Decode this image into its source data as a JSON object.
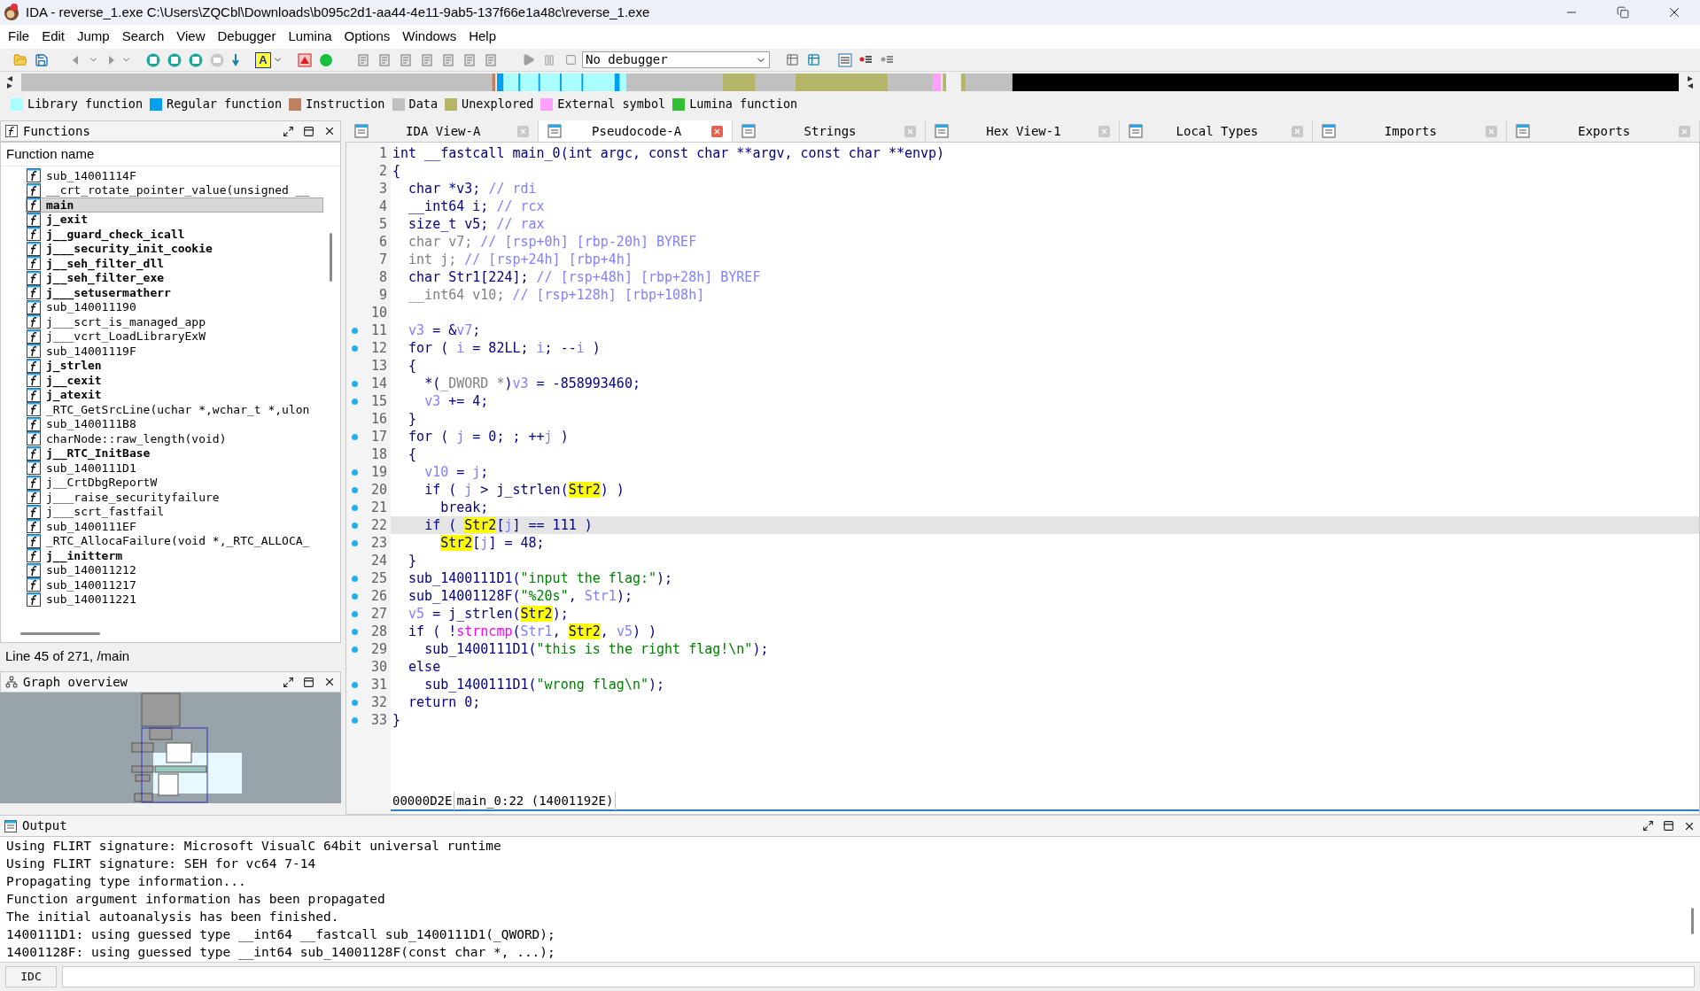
{
  "window": {
    "title": "IDA - reverse_1.exe C:\\Users\\ZQCbl\\Downloads\\b095c2d1-aa44-4e11-9ab5-137f66e1a48c\\reverse_1.exe"
  },
  "menu": [
    "File",
    "Edit",
    "Jump",
    "Search",
    "View",
    "Debugger",
    "Lumina",
    "Options",
    "Windows",
    "Help"
  ],
  "toolbar": {
    "font_button": "A",
    "debugger": "No debugger"
  },
  "legend": [
    {
      "label": "Library function",
      "color": "#aaffff"
    },
    {
      "label": "Regular function",
      "color": "#00a0f0"
    },
    {
      "label": "Instruction",
      "color": "#c08060"
    },
    {
      "label": "Data",
      "color": "#c0c0c0"
    },
    {
      "label": "Unexplored",
      "color": "#b5b56a"
    },
    {
      "label": "External symbol",
      "color": "#ffa0ff"
    },
    {
      "label": "Lumina function",
      "color": "#30c030"
    }
  ],
  "functions": {
    "title": "Functions",
    "column": "Function name",
    "status": "Line 45 of 271, /main",
    "items": [
      {
        "name": "sub_14001114F",
        "bold": false,
        "selected": false
      },
      {
        "name": "__crt_rotate_pointer_value(unsigned __",
        "bold": false,
        "selected": false
      },
      {
        "name": "main",
        "bold": true,
        "selected": true
      },
      {
        "name": "j_exit",
        "bold": true,
        "selected": false
      },
      {
        "name": "j__guard_check_icall",
        "bold": true,
        "selected": false
      },
      {
        "name": "j___security_init_cookie",
        "bold": true,
        "selected": false
      },
      {
        "name": "j__seh_filter_dll",
        "bold": true,
        "selected": false
      },
      {
        "name": "j__seh_filter_exe",
        "bold": true,
        "selected": false
      },
      {
        "name": "j___setusermatherr",
        "bold": true,
        "selected": false
      },
      {
        "name": "sub_140011190",
        "bold": false,
        "selected": false
      },
      {
        "name": "j___scrt_is_managed_app",
        "bold": false,
        "selected": false
      },
      {
        "name": "j___vcrt_LoadLibraryExW",
        "bold": false,
        "selected": false
      },
      {
        "name": "sub_14001119F",
        "bold": false,
        "selected": false
      },
      {
        "name": "j_strlen",
        "bold": true,
        "selected": false
      },
      {
        "name": "j__cexit",
        "bold": true,
        "selected": false
      },
      {
        "name": "j_atexit",
        "bold": true,
        "selected": false
      },
      {
        "name": "_RTC_GetSrcLine(uchar *,wchar_t *,ulon",
        "bold": false,
        "selected": false
      },
      {
        "name": "sub_1400111B8",
        "bold": false,
        "selected": false
      },
      {
        "name": "charNode::raw_length(void)",
        "bold": false,
        "selected": false
      },
      {
        "name": "j__RTC_InitBase",
        "bold": true,
        "selected": false
      },
      {
        "name": "sub_1400111D1",
        "bold": false,
        "selected": false
      },
      {
        "name": "j__CrtDbgReportW",
        "bold": false,
        "selected": false
      },
      {
        "name": "j___raise_securityfailure",
        "bold": false,
        "selected": false
      },
      {
        "name": "j___scrt_fastfail",
        "bold": false,
        "selected": false
      },
      {
        "name": "sub_1400111EF",
        "bold": false,
        "selected": false
      },
      {
        "name": "_RTC_AllocaFailure(void *,_RTC_ALLOCA_",
        "bold": false,
        "selected": false
      },
      {
        "name": "j__initterm",
        "bold": true,
        "selected": false
      },
      {
        "name": "sub_140011212",
        "bold": false,
        "selected": false
      },
      {
        "name": "sub_140011217",
        "bold": false,
        "selected": false
      },
      {
        "name": "sub_140011221",
        "bold": false,
        "selected": false
      }
    ]
  },
  "graph_overview": {
    "title": "Graph overview"
  },
  "tabs": [
    {
      "label": "IDA View-A",
      "selected": false
    },
    {
      "label": "Pseudocode-A",
      "selected": true
    },
    {
      "label": "Strings",
      "selected": false
    },
    {
      "label": "Hex View-1",
      "selected": false
    },
    {
      "label": "Local Types",
      "selected": false
    },
    {
      "label": "Imports",
      "selected": false
    },
    {
      "label": "Exports",
      "selected": false
    }
  ],
  "code": {
    "lines": [
      {
        "n": "1",
        "marked": false,
        "current": false,
        "tokens": [
          {
            "text": "int __fastcall main_0(int argc, const char **argv, const char **envp)",
            "kind": "plain"
          }
        ]
      },
      {
        "n": "2",
        "marked": false,
        "current": false,
        "tokens": [
          {
            "text": "{",
            "kind": "plain"
          }
        ]
      },
      {
        "n": "3",
        "marked": false,
        "current": false,
        "tokens": [
          {
            "text": "  char *v3; ",
            "kind": "plain"
          },
          {
            "text": "// rdi",
            "kind": "comment"
          }
        ]
      },
      {
        "n": "4",
        "marked": false,
        "current": false,
        "tokens": [
          {
            "text": "  __int64 i; ",
            "kind": "plain"
          },
          {
            "text": "// rcx",
            "kind": "comment"
          }
        ]
      },
      {
        "n": "5",
        "marked": false,
        "current": false,
        "tokens": [
          {
            "text": "  size_t v5; ",
            "kind": "plain"
          },
          {
            "text": "// rax",
            "kind": "comment"
          }
        ]
      },
      {
        "n": "6",
        "marked": false,
        "current": false,
        "tokens": [
          {
            "text": "  char v7; ",
            "kind": "dim"
          },
          {
            "text": "// [rsp+0h] [rbp-20h] BYREF",
            "kind": "comment"
          }
        ]
      },
      {
        "n": "7",
        "marked": false,
        "current": false,
        "tokens": [
          {
            "text": "  int j; ",
            "kind": "dim"
          },
          {
            "text": "// [rsp+24h] [rbp+4h]",
            "kind": "comment"
          }
        ]
      },
      {
        "n": "8",
        "marked": false,
        "current": false,
        "tokens": [
          {
            "text": "  char Str1[224]; ",
            "kind": "plain"
          },
          {
            "text": "// [rsp+48h] [rbp+28h] BYREF",
            "kind": "comment"
          }
        ]
      },
      {
        "n": "9",
        "marked": false,
        "current": false,
        "tokens": [
          {
            "text": "  __int64 v10; ",
            "kind": "dim"
          },
          {
            "text": "// [rsp+128h] [rbp+108h]",
            "kind": "comment"
          }
        ]
      },
      {
        "n": "10",
        "marked": false,
        "current": false
      },
      {
        "n": "11",
        "marked": true,
        "current": false,
        "tokens": [
          {
            "text": "  v3",
            "kind": "var"
          },
          {
            "text": " = &",
            "kind": "plain"
          },
          {
            "text": "v7",
            "kind": "var"
          },
          {
            "text": ";",
            "kind": "plain"
          }
        ]
      },
      {
        "n": "12",
        "marked": true,
        "current": false,
        "tokens": [
          {
            "text": "  for ( ",
            "kind": "plain"
          },
          {
            "text": "i",
            "kind": "var"
          },
          {
            "text": " = 82LL; ",
            "kind": "plain"
          },
          {
            "text": "i",
            "kind": "var"
          },
          {
            "text": "; --",
            "kind": "plain"
          },
          {
            "text": "i",
            "kind": "var"
          },
          {
            "text": " )",
            "kind": "plain"
          }
        ]
      },
      {
        "n": "13",
        "marked": false,
        "current": false,
        "tokens": [
          {
            "text": "  {",
            "kind": "plain"
          }
        ]
      },
      {
        "n": "14",
        "marked": true,
        "current": false,
        "tokens": [
          {
            "text": "    *(",
            "kind": "plain"
          },
          {
            "text": "_DWORD *",
            "kind": "dim"
          },
          {
            "text": ")",
            "kind": "plain"
          },
          {
            "text": "v3",
            "kind": "var"
          },
          {
            "text": " = -858993460;",
            "kind": "plain"
          }
        ]
      },
      {
        "n": "15",
        "marked": true,
        "current": false,
        "tokens": [
          {
            "text": "    v3",
            "kind": "var"
          },
          {
            "text": " += 4;",
            "kind": "plain"
          }
        ]
      },
      {
        "n": "16",
        "marked": false,
        "current": false,
        "tokens": [
          {
            "text": "  }",
            "kind": "plain"
          }
        ]
      },
      {
        "n": "17",
        "marked": true,
        "current": false,
        "tokens": [
          {
            "text": "  for ( ",
            "kind": "plain"
          },
          {
            "text": "j",
            "kind": "var"
          },
          {
            "text": " = 0; ; ++",
            "kind": "plain"
          },
          {
            "text": "j",
            "kind": "var"
          },
          {
            "text": " )",
            "kind": "plain"
          }
        ]
      },
      {
        "n": "18",
        "marked": false,
        "current": false,
        "tokens": [
          {
            "text": "  {",
            "kind": "plain"
          }
        ]
      },
      {
        "n": "19",
        "marked": true,
        "current": false,
        "tokens": [
          {
            "text": "    v10",
            "kind": "var"
          },
          {
            "text": " = ",
            "kind": "plain"
          },
          {
            "text": "j",
            "kind": "var"
          },
          {
            "text": ";",
            "kind": "plain"
          }
        ]
      },
      {
        "n": "20",
        "marked": true,
        "current": false,
        "tokens": [
          {
            "text": "    if ( ",
            "kind": "plain"
          },
          {
            "text": "j",
            "kind": "var"
          },
          {
            "text": " > j_strlen(",
            "kind": "plain"
          },
          {
            "text": "Str2",
            "kind": "highlight"
          },
          {
            "text": ") )",
            "kind": "plain"
          }
        ]
      },
      {
        "n": "21",
        "marked": true,
        "current": false,
        "tokens": [
          {
            "text": "      break;",
            "kind": "plain"
          }
        ]
      },
      {
        "n": "22",
        "marked": true,
        "current": true,
        "tokens": [
          {
            "text": "    if ( ",
            "kind": "plain"
          },
          {
            "text": "Str2",
            "kind": "highlight"
          },
          {
            "text": "[",
            "kind": "plain"
          },
          {
            "text": "j",
            "kind": "var"
          },
          {
            "text": "] == 111 )",
            "kind": "plain"
          }
        ]
      },
      {
        "n": "23",
        "marked": true,
        "current": false,
        "tokens": [
          {
            "text": "      Str2",
            "kind": "highlight"
          },
          {
            "text": "[",
            "kind": "plain"
          },
          {
            "text": "j",
            "kind": "var"
          },
          {
            "text": "] = 48;",
            "kind": "plain"
          }
        ]
      },
      {
        "n": "24",
        "marked": false,
        "current": false,
        "tokens": [
          {
            "text": "  }",
            "kind": "plain"
          }
        ]
      },
      {
        "n": "25",
        "marked": true,
        "current": false,
        "tokens": [
          {
            "text": "  sub_1400111D1(",
            "kind": "plain"
          },
          {
            "text": "\"input the flag:\"",
            "kind": "string"
          },
          {
            "text": ");",
            "kind": "plain"
          }
        ]
      },
      {
        "n": "26",
        "marked": true,
        "current": false,
        "tokens": [
          {
            "text": "  sub_14001128F(",
            "kind": "plain"
          },
          {
            "text": "\"%20s\"",
            "kind": "string"
          },
          {
            "text": ", ",
            "kind": "plain"
          },
          {
            "text": "Str1",
            "kind": "var"
          },
          {
            "text": ");",
            "kind": "plain"
          }
        ]
      },
      {
        "n": "27",
        "marked": true,
        "current": false,
        "tokens": [
          {
            "text": "  v5",
            "kind": "var"
          },
          {
            "text": " = j_strlen(",
            "kind": "plain"
          },
          {
            "text": "Str2",
            "kind": "highlight"
          },
          {
            "text": ");",
            "kind": "plain"
          }
        ]
      },
      {
        "n": "28",
        "marked": true,
        "current": false,
        "tokens": [
          {
            "text": "  if ( !",
            "kind": "plain"
          },
          {
            "text": "strncmp",
            "kind": "import"
          },
          {
            "text": "(",
            "kind": "plain"
          },
          {
            "text": "Str1",
            "kind": "var"
          },
          {
            "text": ", ",
            "kind": "plain"
          },
          {
            "text": "Str2",
            "kind": "highlight"
          },
          {
            "text": ", ",
            "kind": "plain"
          },
          {
            "text": "v5",
            "kind": "var"
          },
          {
            "text": ") )",
            "kind": "plain"
          }
        ]
      },
      {
        "n": "29",
        "marked": true,
        "current": false,
        "tokens": [
          {
            "text": "    sub_1400111D1(",
            "kind": "plain"
          },
          {
            "text": "\"this is the right flag!\\n\"",
            "kind": "string"
          },
          {
            "text": ");",
            "kind": "plain"
          }
        ]
      },
      {
        "n": "30",
        "marked": false,
        "current": false,
        "tokens": [
          {
            "text": "  else",
            "kind": "plain"
          }
        ]
      },
      {
        "n": "31",
        "marked": true,
        "current": false,
        "tokens": [
          {
            "text": "    sub_1400111D1(",
            "kind": "plain"
          },
          {
            "text": "\"wrong flag\\n\"",
            "kind": "string"
          },
          {
            "text": ");",
            "kind": "plain"
          }
        ]
      },
      {
        "n": "32",
        "marked": true,
        "current": false,
        "tokens": [
          {
            "text": "  return 0;",
            "kind": "plain"
          }
        ]
      },
      {
        "n": "33",
        "marked": true,
        "current": false,
        "tokens": [
          {
            "text": "}",
            "kind": "plain"
          }
        ]
      }
    ],
    "status": [
      "00000D2E",
      "main_0:22 (14001192E)"
    ]
  },
  "output": {
    "title": "Output",
    "lines": [
      "Using FLIRT signature: Microsoft VisualC 64bit universal runtime",
      "Using FLIRT signature: SEH for vc64 7-14",
      "Propagating type information...",
      "Function argument information has been propagated",
      "The initial autoanalysis has been finished.",
      "1400111D1: using guessed type __int64 __fastcall sub_1400111D1(_QWORD);",
      "14001128F: using guessed type __int64 sub_14001128F(const char *, ...);"
    ],
    "command_button": "IDC"
  }
}
